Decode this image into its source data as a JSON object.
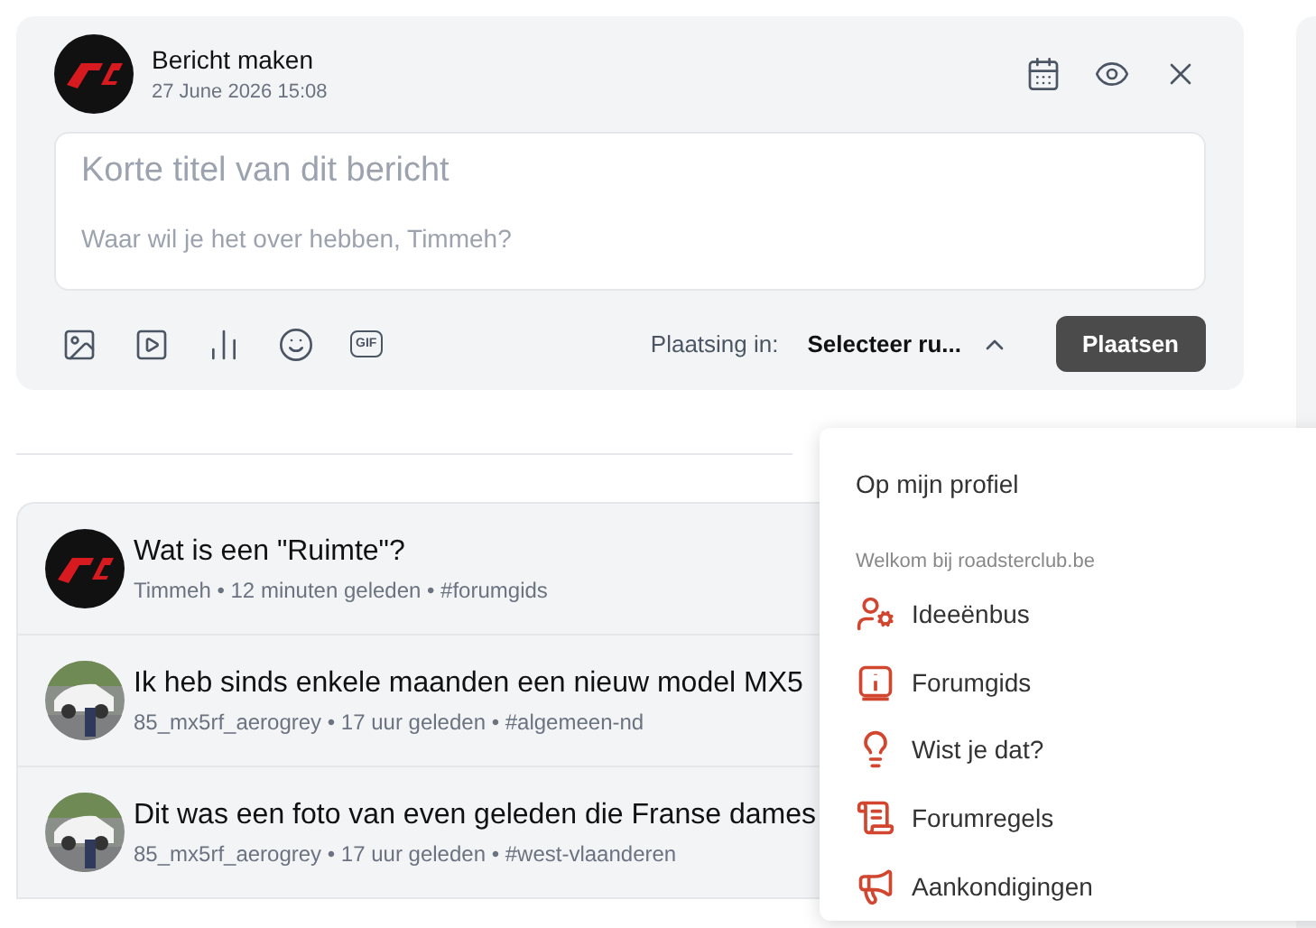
{
  "composer": {
    "title": "Bericht maken",
    "date": "27 June 2026 15:08",
    "title_placeholder": "Korte titel van dit bericht",
    "body_placeholder": "Waar wil je het over hebben, Timmeh?",
    "gif_label": "GIF",
    "placement_label": "Plaatsing in:",
    "placement_value": "Selecteer ru...",
    "placement_expanded": true,
    "submit": "Plaatsen"
  },
  "posts": [
    {
      "kind": "logo",
      "title": "Wat is een \"Ruimte\"?",
      "meta": "Timmeh • 12 minuten geleden • #forumgids"
    },
    {
      "title": "Ik heb sinds enkele maanden een nieuw model MX5",
      "meta": "85_mx5rf_aerogrey • 17 uur geleden • #algemeen-nd"
    },
    {
      "title": "Dit was een foto van even geleden die Franse dames",
      "meta": "85_mx5rf_aerogrey • 17 uur geleden • #west-vlaanderen"
    }
  ],
  "dropdown": {
    "top_option": "Op mijn profiel",
    "section": "Welkom bij roadsterclub.be",
    "options": [
      {
        "kind": "ideas",
        "label": "Ideeënbus"
      },
      {
        "kind": "guide",
        "label": "Forumgids"
      },
      {
        "kind": "tip",
        "label": "Wist je dat?"
      },
      {
        "kind": "rules",
        "label": "Forumregels"
      },
      {
        "kind": "announce",
        "label": "Aankondigingen"
      }
    ]
  }
}
